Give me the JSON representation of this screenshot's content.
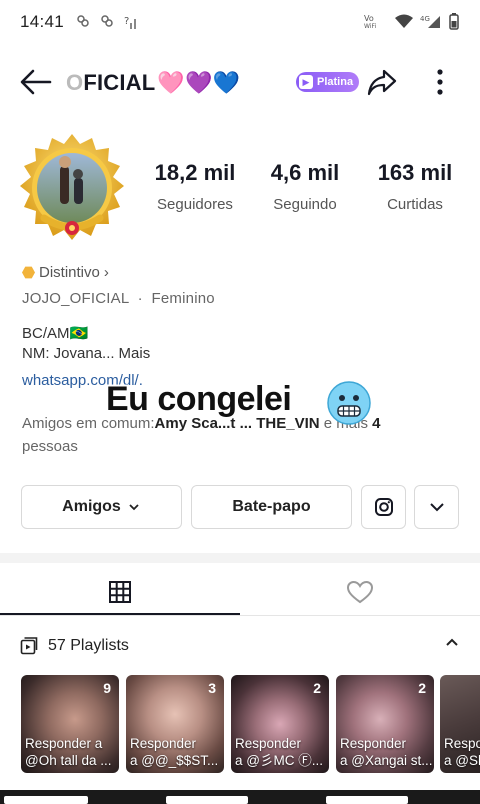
{
  "status_bar": {
    "time": "14:41",
    "left_icons": [
      "dog-glyph",
      "dog-glyph",
      "question-signal"
    ],
    "right_icons": [
      "vowifi",
      "wifi",
      "4g-signal",
      "battery"
    ]
  },
  "header": {
    "username_partial": "FICIAL",
    "username_fade": "O",
    "hearts": "🩷💜💙",
    "badge_label": "Platina",
    "badge_color": "#8a5cf6"
  },
  "stats": [
    {
      "value": "18,2 mil",
      "label": "Seguidores"
    },
    {
      "value": "4,6 mil",
      "label": "Seguindo"
    },
    {
      "value": "163 mil",
      "label": "Curtidas"
    }
  ],
  "profile": {
    "badge_text": "Distintivo",
    "badge_chevron": "›",
    "id_line": "JOJO_OFICIAL  ·  Feminino",
    "bio_line1": "BC/AM🇧🇷",
    "bio_line2": "NM: Jovana...",
    "bio_more": "Mais",
    "link": "whatsapp.com/dl/.",
    "friends_prefix": "Amigos em comum:",
    "friends_names": "Amy Sca...t ... THE_VIN",
    "friends_and": " e mais ",
    "friends_count": "4",
    "friends_suffix": "pessoas"
  },
  "overlay": {
    "caption": "Eu congelei",
    "emoji": "freezing-face"
  },
  "actions": {
    "friends_label": "Amigos",
    "chat_label": "Bate-papo"
  },
  "playlists": {
    "title": "57 Playlists",
    "items": [
      {
        "count": "9",
        "caption_line1": "Responder a",
        "caption_line2": "@Oh tall da ..."
      },
      {
        "count": "3",
        "caption_line1": "Responder",
        "caption_line2": "a @@_$$ST..."
      },
      {
        "count": "2",
        "caption_line1": "Responder",
        "caption_line2": "a @彡MC Ⓕ..."
      },
      {
        "count": "2",
        "caption_line1": "Responder",
        "caption_line2": "a @Xangai st..."
      },
      {
        "count": "",
        "caption_line1": "Respo",
        "caption_line2": "a @Sh"
      }
    ]
  },
  "colors": {
    "text": "#161823",
    "link": "#2b5d9f",
    "badge_gold": "#f2b33a"
  }
}
